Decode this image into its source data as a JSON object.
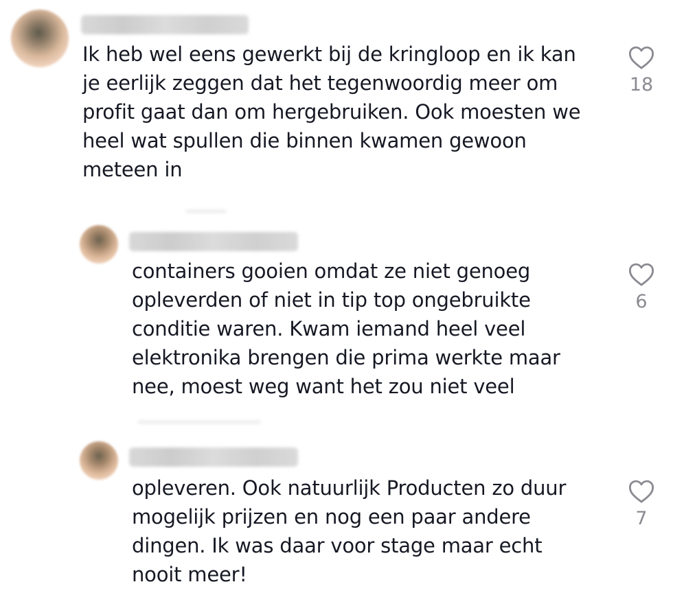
{
  "comments": [
    {
      "text": "Ik heb wel eens gewerkt bij de kringloop en ik kan\nje eerlijk zeggen dat het tegenwoordig meer om\nprofit gaat dan om hergebruiken. Ook moesten we\nheel wat spullen die binnen kwamen gewoon\nmeteen in",
      "likes": "18"
    },
    {
      "text": "containers gooien omdat ze niet genoeg\nopleverden of niet in tip top ongebruikte\nconditie waren. Kwam iemand heel veel\nelektronika brengen die prima werkte maar\nnee, moest weg want het zou niet veel",
      "likes": "6"
    },
    {
      "text": "opleveren. Ook natuurlijk Producten zo duur\nmogelijk prijzen en nog een paar andere\ndingen. Ik was daar voor stage maar echt\nnooit meer!",
      "likes": "7"
    }
  ],
  "icons": {
    "like": "heart-outline-icon",
    "avatar": "blurred-avatar"
  },
  "colors": {
    "text": "#161823",
    "like_count": "#8a8b91",
    "heart_stroke": "#8a8b91"
  }
}
